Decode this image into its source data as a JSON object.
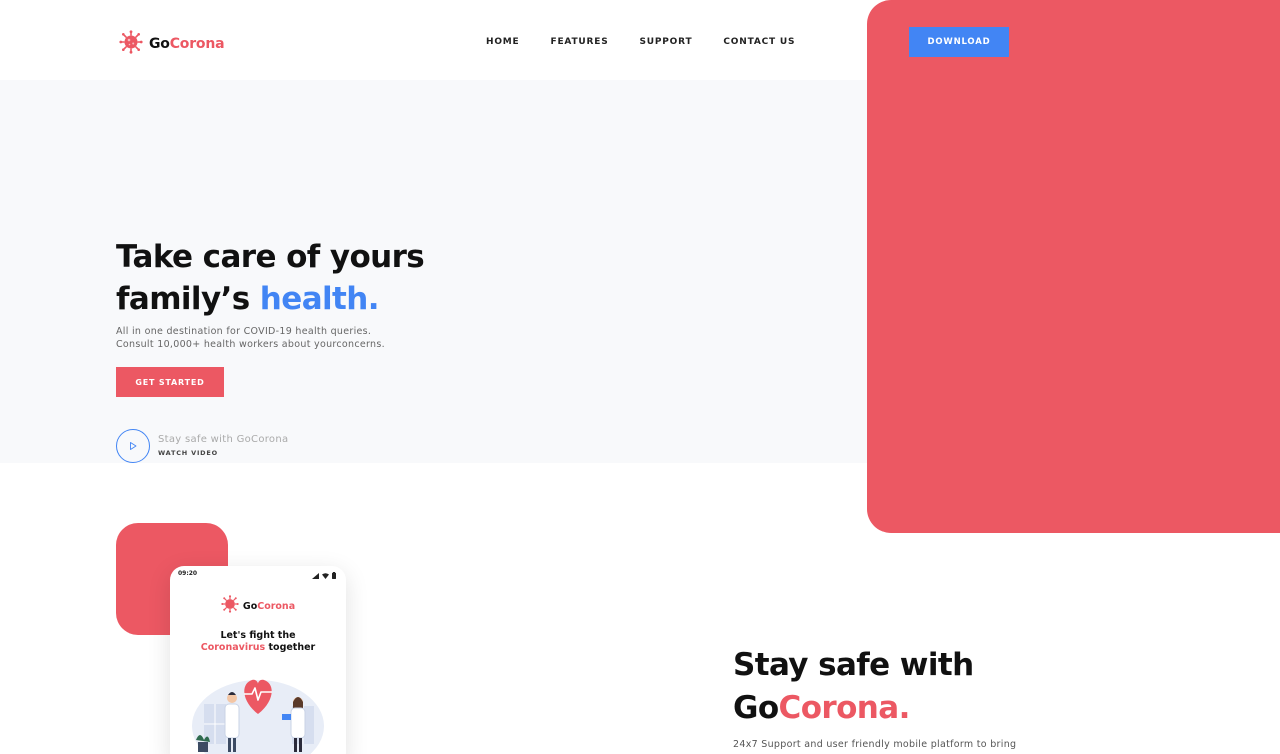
{
  "header": {
    "logo": {
      "part1": "Go",
      "part2": "Corona"
    },
    "nav": [
      {
        "label": "HOME"
      },
      {
        "label": "FEATURES"
      },
      {
        "label": "SUPPORT"
      },
      {
        "label": "CONTACT US"
      }
    ],
    "download_label": "DOWNLOAD"
  },
  "hero": {
    "title_line1": "Take care of yours",
    "title_line2_prefix": "family’s ",
    "title_line2_highlight": "health.",
    "subtitle_line1": "All in one destination for COVID-19 health queries.",
    "subtitle_line2": "Consult 10,000+ health workers about yourconcerns.",
    "cta_label": "GET STARTED",
    "video_title": "Stay safe with GoCorona",
    "video_link": "WATCH VIDEO"
  },
  "phone": {
    "time": "09:20",
    "logo": {
      "part1": "Go",
      "part2": "Corona"
    },
    "headline_line1": "Let's fight the",
    "headline_highlight": "Coronavirus",
    "headline_rest": " together"
  },
  "section2": {
    "title_line1": "Stay safe with",
    "title_part1": "Go",
    "title_part2": "Corona.",
    "body": "24x7 Support and user friendly mobile platform to bring"
  },
  "colors": {
    "brand_red": "#ec5863",
    "accent_blue": "#4285f4",
    "hero_bg": "#f8f9fb"
  },
  "icons": {
    "logo": "virus-icon",
    "play": "play-icon"
  }
}
